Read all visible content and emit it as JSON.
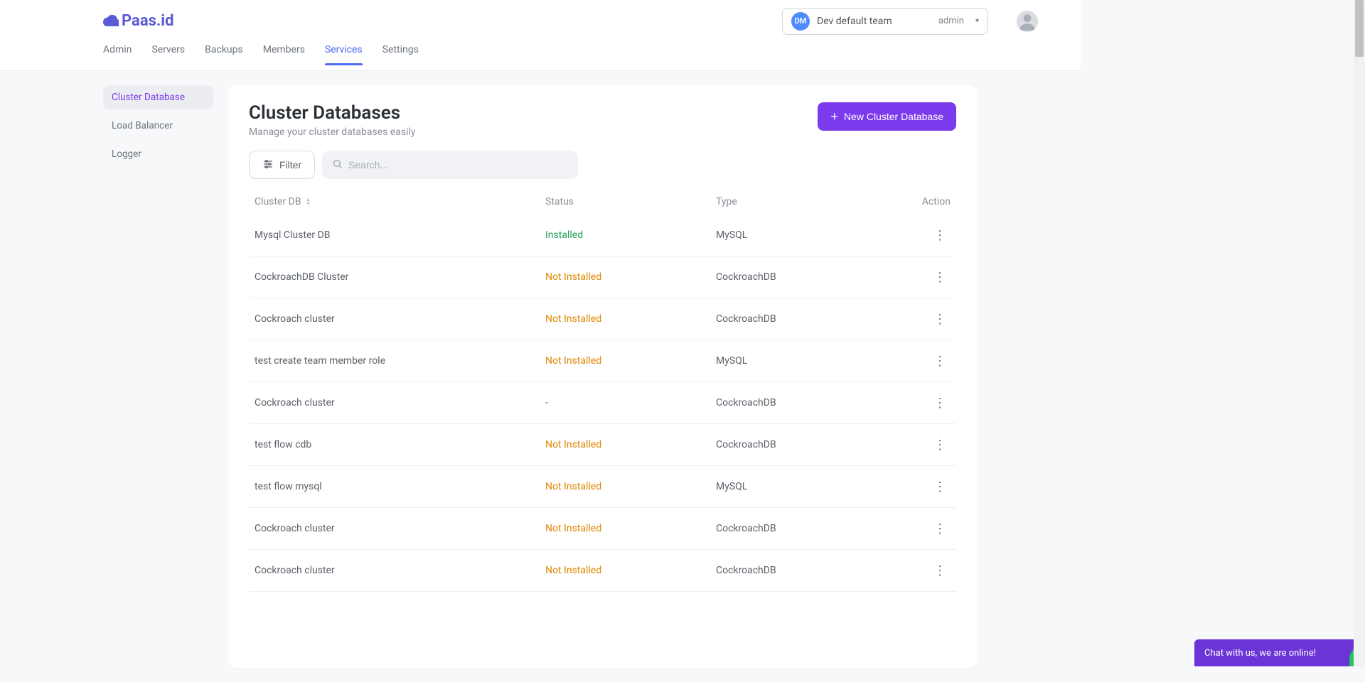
{
  "brand": "Paas.id",
  "team": {
    "avatar": "DM",
    "name": "Dev default team",
    "role": "admin"
  },
  "nav": [
    {
      "label": "Admin",
      "active": false
    },
    {
      "label": "Servers",
      "active": false
    },
    {
      "label": "Backups",
      "active": false
    },
    {
      "label": "Members",
      "active": false
    },
    {
      "label": "Services",
      "active": true
    },
    {
      "label": "Settings",
      "active": false
    }
  ],
  "sidebar": [
    {
      "label": "Cluster Database",
      "active": true
    },
    {
      "label": "Load Balancer",
      "active": false
    },
    {
      "label": "Logger",
      "active": false
    }
  ],
  "page": {
    "title": "Cluster Databases",
    "subtitle": "Manage your cluster databases easily",
    "new_button": "New Cluster Database",
    "filter_label": "Filter",
    "search_placeholder": "Search..."
  },
  "table": {
    "columns": {
      "cluster": "Cluster DB",
      "status": "Status",
      "type": "Type",
      "action": "Action"
    },
    "rows": [
      {
        "name": "Mysql Cluster DB",
        "status": "Installed",
        "status_kind": "installed",
        "type": "MySQL"
      },
      {
        "name": "CockroachDB Cluster",
        "status": "Not Installed",
        "status_kind": "not",
        "type": "CockroachDB"
      },
      {
        "name": "Cockroach cluster",
        "status": "Not Installed",
        "status_kind": "not",
        "type": "CockroachDB"
      },
      {
        "name": "test create team member role",
        "status": "Not Installed",
        "status_kind": "not",
        "type": "MySQL"
      },
      {
        "name": "Cockroach cluster",
        "status": "-",
        "status_kind": "dash",
        "type": "CockroachDB"
      },
      {
        "name": "test flow cdb",
        "status": "Not Installed",
        "status_kind": "not",
        "type": "CockroachDB"
      },
      {
        "name": "test flow mysql",
        "status": "Not Installed",
        "status_kind": "not",
        "type": "MySQL"
      },
      {
        "name": "Cockroach cluster",
        "status": "Not Installed",
        "status_kind": "not",
        "type": "CockroachDB"
      },
      {
        "name": "Cockroach cluster",
        "status": "Not Installed",
        "status_kind": "not",
        "type": "CockroachDB"
      }
    ]
  },
  "chat": {
    "text": "Chat with us, we are online!"
  }
}
